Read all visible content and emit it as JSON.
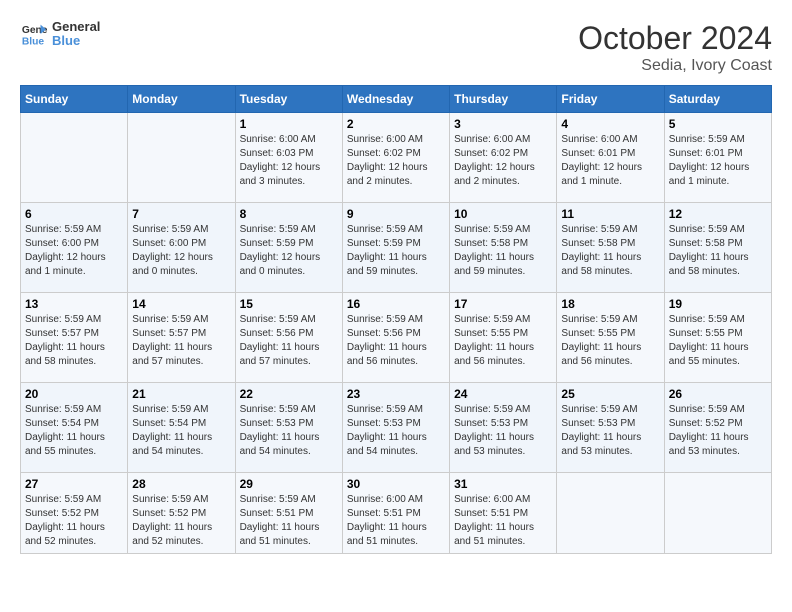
{
  "logo": {
    "text_general": "General",
    "text_blue": "Blue"
  },
  "header": {
    "month": "October 2024",
    "location": "Sedia, Ivory Coast"
  },
  "days_of_week": [
    "Sunday",
    "Monday",
    "Tuesday",
    "Wednesday",
    "Thursday",
    "Friday",
    "Saturday"
  ],
  "weeks": [
    [
      {
        "day": "",
        "empty": true
      },
      {
        "day": "",
        "empty": true
      },
      {
        "day": "1",
        "sunrise": "Sunrise: 6:00 AM",
        "sunset": "Sunset: 6:03 PM",
        "daylight": "Daylight: 12 hours and 3 minutes."
      },
      {
        "day": "2",
        "sunrise": "Sunrise: 6:00 AM",
        "sunset": "Sunset: 6:02 PM",
        "daylight": "Daylight: 12 hours and 2 minutes."
      },
      {
        "day": "3",
        "sunrise": "Sunrise: 6:00 AM",
        "sunset": "Sunset: 6:02 PM",
        "daylight": "Daylight: 12 hours and 2 minutes."
      },
      {
        "day": "4",
        "sunrise": "Sunrise: 6:00 AM",
        "sunset": "Sunset: 6:01 PM",
        "daylight": "Daylight: 12 hours and 1 minute."
      },
      {
        "day": "5",
        "sunrise": "Sunrise: 5:59 AM",
        "sunset": "Sunset: 6:01 PM",
        "daylight": "Daylight: 12 hours and 1 minute."
      }
    ],
    [
      {
        "day": "6",
        "sunrise": "Sunrise: 5:59 AM",
        "sunset": "Sunset: 6:00 PM",
        "daylight": "Daylight: 12 hours and 1 minute."
      },
      {
        "day": "7",
        "sunrise": "Sunrise: 5:59 AM",
        "sunset": "Sunset: 6:00 PM",
        "daylight": "Daylight: 12 hours and 0 minutes."
      },
      {
        "day": "8",
        "sunrise": "Sunrise: 5:59 AM",
        "sunset": "Sunset: 5:59 PM",
        "daylight": "Daylight: 12 hours and 0 minutes."
      },
      {
        "day": "9",
        "sunrise": "Sunrise: 5:59 AM",
        "sunset": "Sunset: 5:59 PM",
        "daylight": "Daylight: 11 hours and 59 minutes."
      },
      {
        "day": "10",
        "sunrise": "Sunrise: 5:59 AM",
        "sunset": "Sunset: 5:58 PM",
        "daylight": "Daylight: 11 hours and 59 minutes."
      },
      {
        "day": "11",
        "sunrise": "Sunrise: 5:59 AM",
        "sunset": "Sunset: 5:58 PM",
        "daylight": "Daylight: 11 hours and 58 minutes."
      },
      {
        "day": "12",
        "sunrise": "Sunrise: 5:59 AM",
        "sunset": "Sunset: 5:58 PM",
        "daylight": "Daylight: 11 hours and 58 minutes."
      }
    ],
    [
      {
        "day": "13",
        "sunrise": "Sunrise: 5:59 AM",
        "sunset": "Sunset: 5:57 PM",
        "daylight": "Daylight: 11 hours and 58 minutes."
      },
      {
        "day": "14",
        "sunrise": "Sunrise: 5:59 AM",
        "sunset": "Sunset: 5:57 PM",
        "daylight": "Daylight: 11 hours and 57 minutes."
      },
      {
        "day": "15",
        "sunrise": "Sunrise: 5:59 AM",
        "sunset": "Sunset: 5:56 PM",
        "daylight": "Daylight: 11 hours and 57 minutes."
      },
      {
        "day": "16",
        "sunrise": "Sunrise: 5:59 AM",
        "sunset": "Sunset: 5:56 PM",
        "daylight": "Daylight: 11 hours and 56 minutes."
      },
      {
        "day": "17",
        "sunrise": "Sunrise: 5:59 AM",
        "sunset": "Sunset: 5:55 PM",
        "daylight": "Daylight: 11 hours and 56 minutes."
      },
      {
        "day": "18",
        "sunrise": "Sunrise: 5:59 AM",
        "sunset": "Sunset: 5:55 PM",
        "daylight": "Daylight: 11 hours and 56 minutes."
      },
      {
        "day": "19",
        "sunrise": "Sunrise: 5:59 AM",
        "sunset": "Sunset: 5:55 PM",
        "daylight": "Daylight: 11 hours and 55 minutes."
      }
    ],
    [
      {
        "day": "20",
        "sunrise": "Sunrise: 5:59 AM",
        "sunset": "Sunset: 5:54 PM",
        "daylight": "Daylight: 11 hours and 55 minutes."
      },
      {
        "day": "21",
        "sunrise": "Sunrise: 5:59 AM",
        "sunset": "Sunset: 5:54 PM",
        "daylight": "Daylight: 11 hours and 54 minutes."
      },
      {
        "day": "22",
        "sunrise": "Sunrise: 5:59 AM",
        "sunset": "Sunset: 5:53 PM",
        "daylight": "Daylight: 11 hours and 54 minutes."
      },
      {
        "day": "23",
        "sunrise": "Sunrise: 5:59 AM",
        "sunset": "Sunset: 5:53 PM",
        "daylight": "Daylight: 11 hours and 54 minutes."
      },
      {
        "day": "24",
        "sunrise": "Sunrise: 5:59 AM",
        "sunset": "Sunset: 5:53 PM",
        "daylight": "Daylight: 11 hours and 53 minutes."
      },
      {
        "day": "25",
        "sunrise": "Sunrise: 5:59 AM",
        "sunset": "Sunset: 5:53 PM",
        "daylight": "Daylight: 11 hours and 53 minutes."
      },
      {
        "day": "26",
        "sunrise": "Sunrise: 5:59 AM",
        "sunset": "Sunset: 5:52 PM",
        "daylight": "Daylight: 11 hours and 53 minutes."
      }
    ],
    [
      {
        "day": "27",
        "sunrise": "Sunrise: 5:59 AM",
        "sunset": "Sunset: 5:52 PM",
        "daylight": "Daylight: 11 hours and 52 minutes."
      },
      {
        "day": "28",
        "sunrise": "Sunrise: 5:59 AM",
        "sunset": "Sunset: 5:52 PM",
        "daylight": "Daylight: 11 hours and 52 minutes."
      },
      {
        "day": "29",
        "sunrise": "Sunrise: 5:59 AM",
        "sunset": "Sunset: 5:51 PM",
        "daylight": "Daylight: 11 hours and 51 minutes."
      },
      {
        "day": "30",
        "sunrise": "Sunrise: 6:00 AM",
        "sunset": "Sunset: 5:51 PM",
        "daylight": "Daylight: 11 hours and 51 minutes."
      },
      {
        "day": "31",
        "sunrise": "Sunrise: 6:00 AM",
        "sunset": "Sunset: 5:51 PM",
        "daylight": "Daylight: 11 hours and 51 minutes."
      },
      {
        "day": "",
        "empty": true
      },
      {
        "day": "",
        "empty": true
      }
    ]
  ]
}
